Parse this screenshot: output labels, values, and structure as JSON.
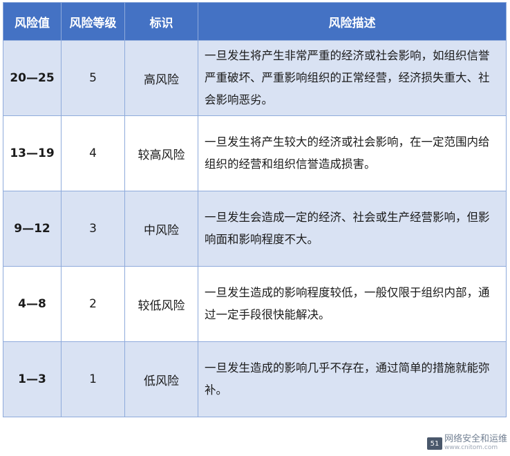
{
  "table": {
    "headers": [
      "风险值",
      "风险等级",
      "标识",
      "风险描述"
    ],
    "rows": [
      {
        "value": "20—25",
        "level": "5",
        "label": "高风险",
        "desc": "一旦发生将产生非常严重的经济或社会影响，如组织信誉严重破坏、严重影响组织的正常经营，经济损失重大、社会影响恶劣。"
      },
      {
        "value": "13—19",
        "level": "4",
        "label": "较高风险",
        "desc": "一旦发生将产生较大的经济或社会影响，在一定范围内给组织的经营和组织信誉造成损害。"
      },
      {
        "value": "9—12",
        "level": "3",
        "label": "中风险",
        "desc": "一旦发生会造成一定的经济、社会或生产经营影响，但影响面和影响程度不大。"
      },
      {
        "value": "4—8",
        "level": "2",
        "label": "较低风险",
        "desc": "一旦发生造成的影响程度较低，一般仅限于组织内部，通过一定手段很快能解决。"
      },
      {
        "value": "1—3",
        "level": "1",
        "label": "低风险",
        "desc": "一旦发生造成的影响几乎不存在，通过简单的措施就能弥补。"
      }
    ]
  },
  "watermark": {
    "logo_text": "51",
    "text": "网络安全和运维",
    "sub": "www.cnitom.com"
  },
  "colors": {
    "header_bg": "#4472c4",
    "alt_row_bg": "#d9e2f3",
    "border": "#8eaadb"
  }
}
